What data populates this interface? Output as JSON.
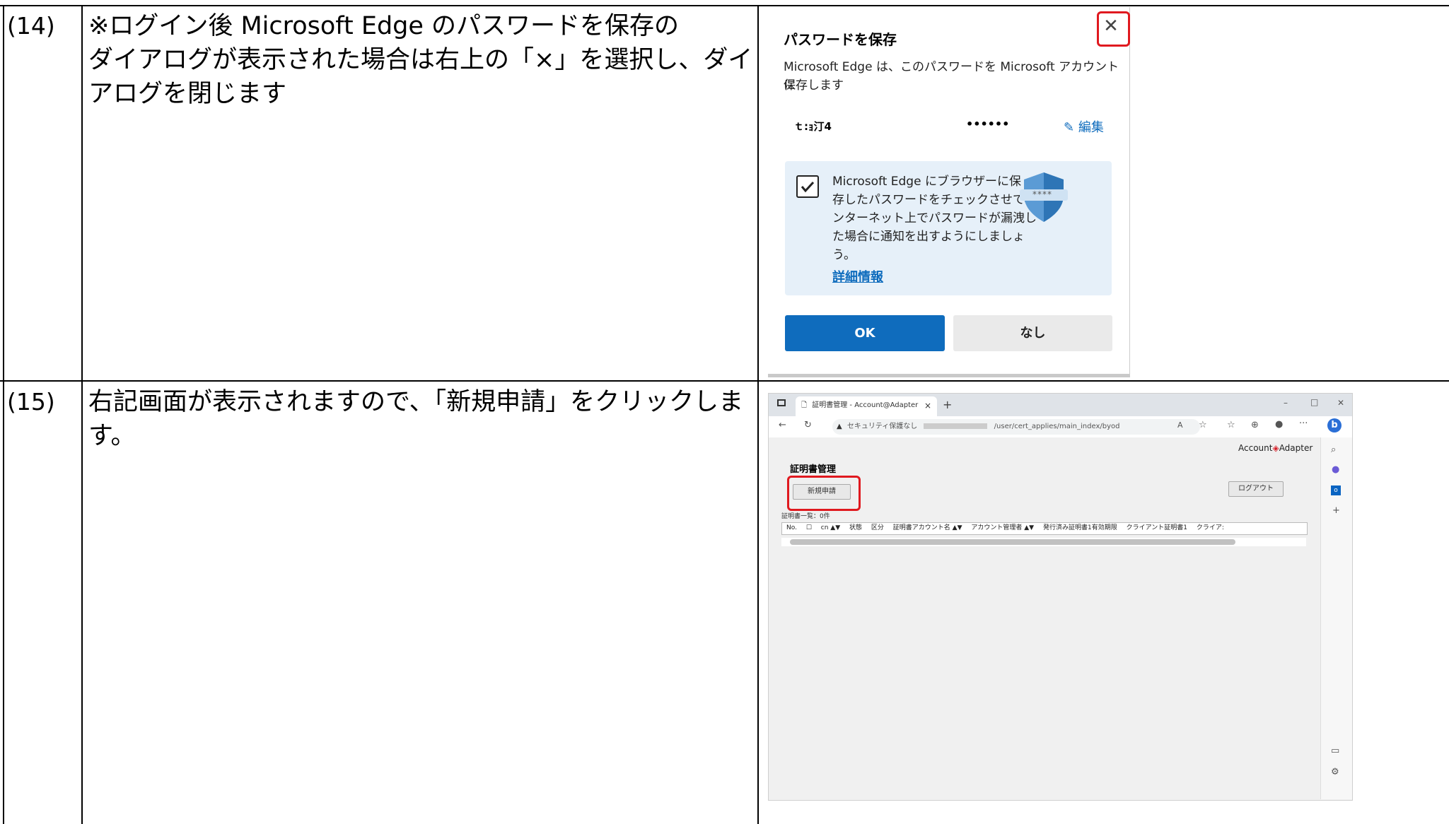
{
  "rows": [
    {
      "number": "(14)",
      "text_lines": [
        "※ログイン後 Microsoft Edge のパスワードを保存の",
        "ダイアログが表示された場合は右上の「×」を選択し、ダイ",
        "アログを閉じます"
      ]
    },
    {
      "number": "(15)",
      "text_lines": [
        "右記画面が表示されますので、「新規申請」をクリックしま",
        "す。"
      ]
    }
  ],
  "dialog": {
    "title": "パスワードを保存",
    "body_line1": "Microsoft Edge は、このパスワードを Microsoft アカウントに",
    "body_line2": "保存します",
    "username": "ｔ:ｮ汀4",
    "password": "••••••",
    "edit_label": "編集",
    "info_lines": [
      "Microsoft Edge にブラウザーに保",
      "存したパスワードをチェックさせて、イ",
      "ンターネット上でパスワードが漏洩し",
      "た場合に通知を出すようにしましょ",
      "う。"
    ],
    "details_link": "詳細情報",
    "ok_label": "OK",
    "none_label": "なし",
    "close_glyph": "✕",
    "shield_text": "****",
    "accent_color": "#0f6cbd",
    "highlight_color": "#e0191f"
  },
  "browser": {
    "tab_title": "証明書管理 - Account@Adapter",
    "tab_close": "×",
    "tab_new": "+",
    "security_label": "セキュリティ保護なし",
    "url_path": "/user/cert_applies/main_index/byod",
    "logo_text": "Account",
    "logo_text2": "Adapter",
    "page_title": "証明書管理",
    "new_request_button": "新規申請",
    "logout_button": "ログアウト",
    "list_label": "証明書一覧：0件",
    "columns": [
      "No.",
      "☐",
      "cn ▲▼",
      "状態",
      "区分",
      "証明書アカウント名 ▲▼",
      "アカウント管理者 ▲▼",
      "発行済み証明書1有効期限",
      "クライアント証明書1",
      "クライア:"
    ],
    "window_min": "–",
    "window_max": "□",
    "window_close": "✕"
  }
}
